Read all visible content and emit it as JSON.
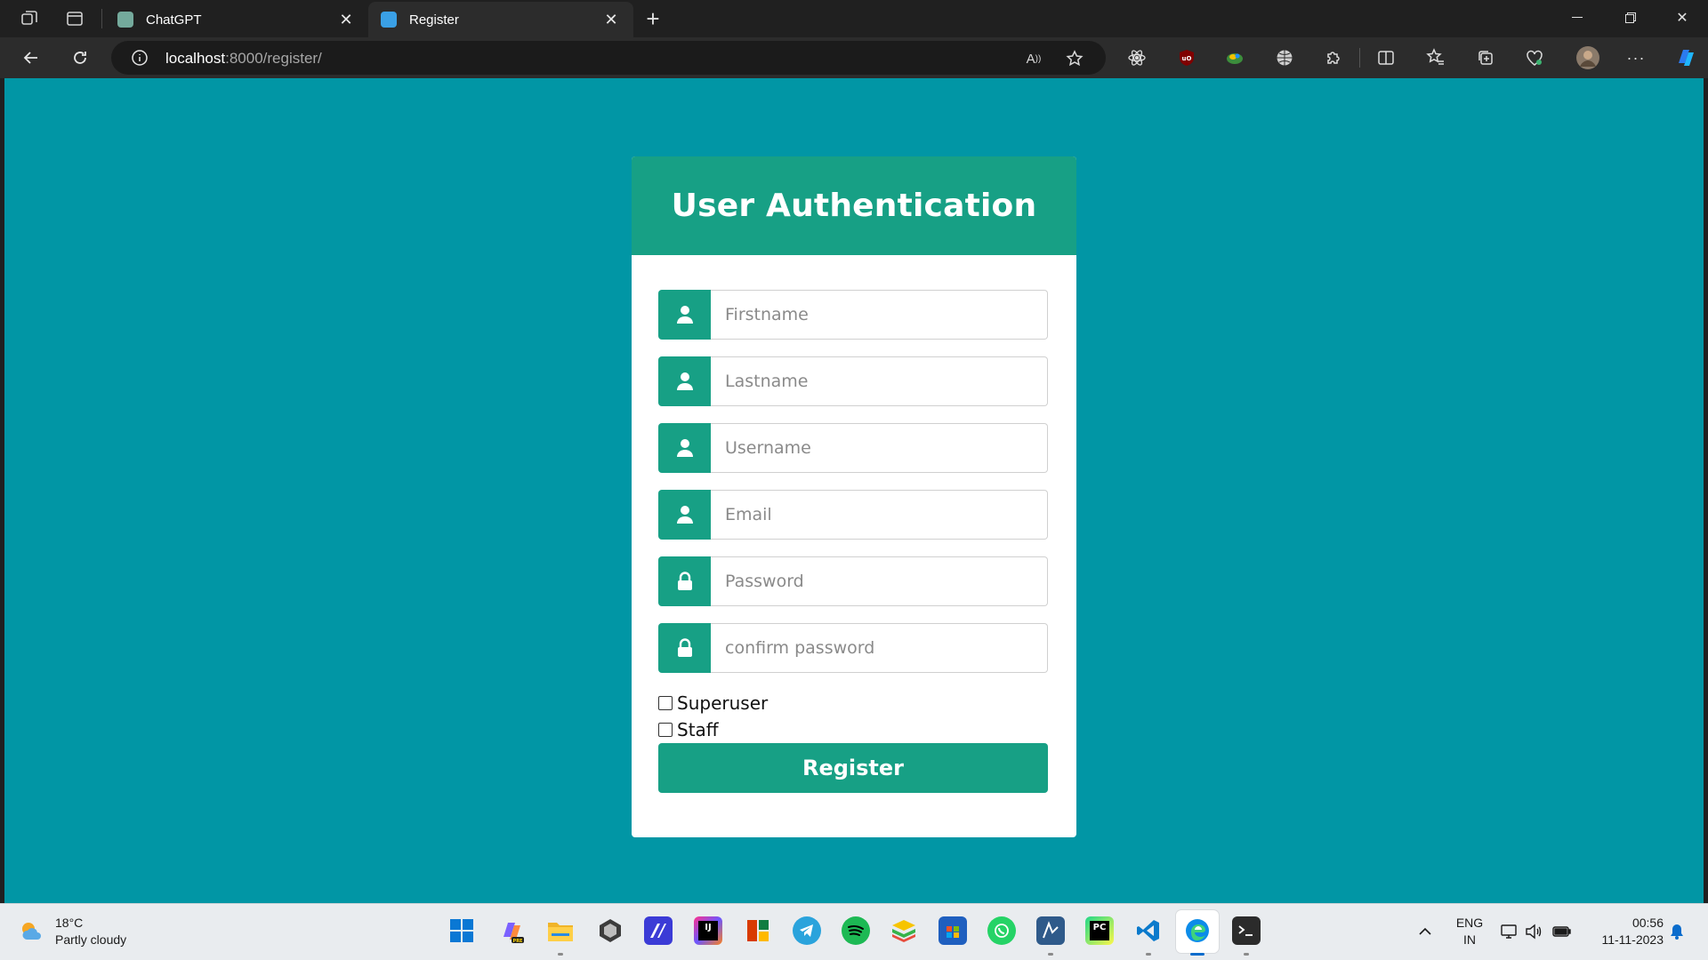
{
  "browser": {
    "tabs": [
      {
        "title": "ChatGPT",
        "active": false
      },
      {
        "title": "Register",
        "active": true
      }
    ],
    "new_tab_label": "+",
    "url_host": "localhost",
    "url_rest": ":8000/register/"
  },
  "form": {
    "heading": "User Authentication",
    "fields": [
      {
        "placeholder": "Firstname",
        "icon": "user-icon"
      },
      {
        "placeholder": "Lastname",
        "icon": "user-icon"
      },
      {
        "placeholder": "Username",
        "icon": "user-icon"
      },
      {
        "placeholder": "Email",
        "icon": "user-icon"
      },
      {
        "placeholder": "Password",
        "icon": "lock-icon"
      },
      {
        "placeholder": "confirm password",
        "icon": "lock-icon"
      }
    ],
    "checkboxes": [
      {
        "label": "Superuser",
        "checked": false
      },
      {
        "label": "Staff",
        "checked": false
      }
    ],
    "submit_label": "Register"
  },
  "taskbar": {
    "weather_temp": "18°C",
    "weather_desc": "Partly cloudy",
    "language_1": "ENG",
    "language_2": "IN",
    "time": "00:56",
    "date": "11-11-2023"
  },
  "colors": {
    "page_background": "#0196a5",
    "accent": "#17a085",
    "card": "#ffffff"
  }
}
